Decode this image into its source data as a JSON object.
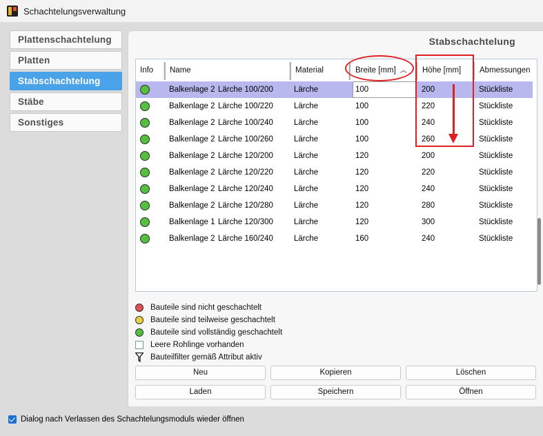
{
  "window": {
    "title": "Schachtelungsverwaltung"
  },
  "nav": {
    "items": [
      {
        "label": "Plattenschachtelung",
        "active": false
      },
      {
        "label": "Platten",
        "active": false
      },
      {
        "label": "Stabschachtelung",
        "active": true
      },
      {
        "label": "Stäbe",
        "active": false
      },
      {
        "label": "Sonstiges",
        "active": false
      }
    ]
  },
  "panel": {
    "title": "Stabschachtelung"
  },
  "table": {
    "headers": {
      "info": "Info",
      "name": "Name",
      "material": "Material",
      "breite": "Breite [mm]",
      "hoehe": "Höhe [mm]",
      "abmessungen": "Abmessungen"
    },
    "sort_column": "breite",
    "sort_direction": "ascending",
    "rows": [
      {
        "status": "green",
        "name_a": "Balkenlage 2",
        "name_b": "Lärche 100/200",
        "material": "Lärche",
        "breite": "100",
        "hoehe": "200",
        "abmessungen": "Stückliste",
        "selected": true
      },
      {
        "status": "green",
        "name_a": "Balkenlage 2",
        "name_b": "Lärche 100/220",
        "material": "Lärche",
        "breite": "100",
        "hoehe": "220",
        "abmessungen": "Stückliste"
      },
      {
        "status": "green",
        "name_a": "Balkenlage 2",
        "name_b": "Lärche 100/240",
        "material": "Lärche",
        "breite": "100",
        "hoehe": "240",
        "abmessungen": "Stückliste"
      },
      {
        "status": "green",
        "name_a": "Balkenlage 2",
        "name_b": "Lärche 100/260",
        "material": "Lärche",
        "breite": "100",
        "hoehe": "260",
        "abmessungen": "Stückliste"
      },
      {
        "status": "green",
        "name_a": "Balkenlage 2",
        "name_b": "Lärche 120/200",
        "material": "Lärche",
        "breite": "120",
        "hoehe": "200",
        "abmessungen": "Stückliste"
      },
      {
        "status": "green",
        "name_a": "Balkenlage 2",
        "name_b": "Lärche 120/220",
        "material": "Lärche",
        "breite": "120",
        "hoehe": "220",
        "abmessungen": "Stückliste"
      },
      {
        "status": "green",
        "name_a": "Balkenlage 2",
        "name_b": "Lärche 120/240",
        "material": "Lärche",
        "breite": "120",
        "hoehe": "240",
        "abmessungen": "Stückliste"
      },
      {
        "status": "green",
        "name_a": "Balkenlage 2",
        "name_b": "Lärche 120/280",
        "material": "Lärche",
        "breite": "120",
        "hoehe": "280",
        "abmessungen": "Stückliste"
      },
      {
        "status": "green",
        "name_a": "Balkenlage 1",
        "name_b": "Lärche 120/300",
        "material": "Lärche",
        "breite": "120",
        "hoehe": "300",
        "abmessungen": "Stückliste"
      },
      {
        "status": "green",
        "name_a": "Balkenlage 2",
        "name_b": "Lärche 160/240",
        "material": "Lärche",
        "breite": "160",
        "hoehe": "240",
        "abmessungen": "Stückliste"
      }
    ]
  },
  "legend": [
    {
      "icon": "red-dot-icon",
      "label": "Bauteile sind nicht geschachtelt"
    },
    {
      "icon": "yellow-dot-icon",
      "label": "Bauteile sind teilweise geschachtelt"
    },
    {
      "icon": "green-dot-icon",
      "label": "Bauteile sind vollständig geschachtelt"
    },
    {
      "icon": "empty-square-icon",
      "label": "Leere Rohlinge vorhanden"
    },
    {
      "icon": "filter-icon",
      "label": "Bauteilfilter gemäß Attribut aktiv"
    }
  ],
  "buttons": {
    "neu": "Neu",
    "kopieren": "Kopieren",
    "loeschen": "Löschen",
    "laden": "Laden",
    "speichern": "Speichern",
    "oeffnen": "Öffnen"
  },
  "footer": {
    "reopen_label": "Dialog nach Verlassen des Schachtelungsmoduls wieder öffnen",
    "reopen_checked": true
  },
  "colors": {
    "accent": "#4aa3e8",
    "selection": "#b8b8ee",
    "annotation": "#e02020",
    "status_green": "#55c040",
    "status_yellow": "#e8d040",
    "status_red": "#e05050"
  }
}
